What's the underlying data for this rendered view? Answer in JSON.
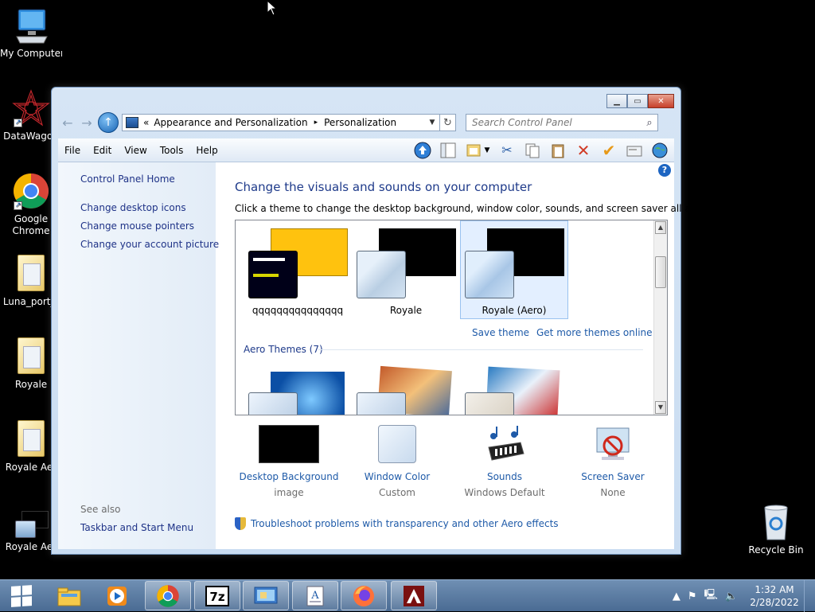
{
  "desktop": {
    "icons": [
      {
        "label": "My Computer"
      },
      {
        "label": "DataWagon"
      },
      {
        "label": "Google Chrome"
      },
      {
        "label": "Luna_port_t"
      },
      {
        "label": "Royale"
      },
      {
        "label": "Royale Aer"
      },
      {
        "label": "Royale Aer"
      },
      {
        "label": "Recycle Bin"
      }
    ]
  },
  "window": {
    "address": {
      "chevron": "«",
      "crumbs": [
        "Appearance and Personalization",
        "Personalization"
      ],
      "separator": "▸"
    },
    "search": {
      "placeholder": "Search Control Panel"
    },
    "menu": [
      "File",
      "Edit",
      "View",
      "Tools",
      "Help"
    ],
    "left_pane": {
      "home": "Control Panel Home",
      "links": [
        "Change desktop icons",
        "Change mouse pointers",
        "Change your account picture"
      ],
      "see_also_title": "See also",
      "see_also_links": [
        "Taskbar and Start Menu"
      ]
    },
    "main": {
      "heading": "Change the visuals and sounds on your computer",
      "subtext": "Click a theme to change the desktop background, window color, sounds, and screen saver all at once.",
      "themes": [
        {
          "name": "qqqqqqqqqqqqqqq"
        },
        {
          "name": "Royale"
        },
        {
          "name": "Royale (Aero)"
        }
      ],
      "save_theme": "Save theme",
      "more_themes": "Get more themes online",
      "group_label": "Aero Themes (7)",
      "options": [
        {
          "title": "Desktop Background",
          "sub": "image"
        },
        {
          "title": "Window Color",
          "sub": "Custom"
        },
        {
          "title": "Sounds",
          "sub": "Windows Default"
        },
        {
          "title": "Screen Saver",
          "sub": "None"
        }
      ],
      "troubleshoot": "Troubleshoot problems with transparency and other Aero effects"
    }
  },
  "taskbar": {
    "clock_time": "1:32 AM",
    "clock_date": "2/28/2022"
  },
  "colors": {
    "link": "#1e5aa8",
    "heading": "#1e3a8a",
    "taskbar": "#5a7aa3"
  }
}
